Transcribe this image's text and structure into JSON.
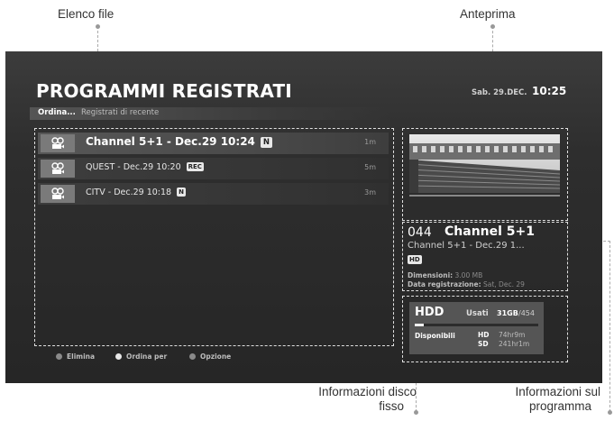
{
  "callouts": {
    "file_list": "Elenco file",
    "preview": "Anteprima",
    "disk_info_1": "Informazioni disco",
    "disk_info_2": "fisso",
    "program_info_1": "Informazioni sul",
    "program_info_2": "programma"
  },
  "header": {
    "title": "PROGRAMMI REGISTRATI",
    "date": "Sab. 29.DEC.",
    "time": "10:25"
  },
  "sort": {
    "label": "Ordina...",
    "value": "Registrati di recente"
  },
  "recordings": [
    {
      "title": "Channel 5+1 - Dec.29 10:24",
      "badge": "N",
      "duration": "1m",
      "selected": true
    },
    {
      "title": "QUEST - Dec.29 10:20",
      "badge": "REC",
      "duration": "5m",
      "selected": false
    },
    {
      "title": "CITV - Dec.29 10:18",
      "badge": "N",
      "duration": "3m",
      "selected": false
    }
  ],
  "legend": [
    {
      "label": "Elimina",
      "color": "#8a8a8a"
    },
    {
      "label": "Ordina per",
      "color": "#e8e8e8"
    },
    {
      "label": "Opzione",
      "color": "#8a8a8a"
    }
  ],
  "program_info": {
    "channel_number": "044",
    "channel_name": "Channel 5+1",
    "program": "Channel 5+1 - Dec.29 1...",
    "badge": "HD",
    "size_label": "Dimensioni:",
    "size_value": "3.00 MB",
    "date_label": "Data registrazione:",
    "date_value": "Sat, Dec. 29"
  },
  "hdd": {
    "title": "HDD",
    "used_label": "Usati",
    "used_value": "31GB",
    "total": "/454",
    "used_fraction": 0.07,
    "available_label": "Disponibili",
    "hd_label": "HD",
    "hd_time": "74hr9m",
    "sd_label": "SD",
    "sd_time": "241hr1m"
  }
}
